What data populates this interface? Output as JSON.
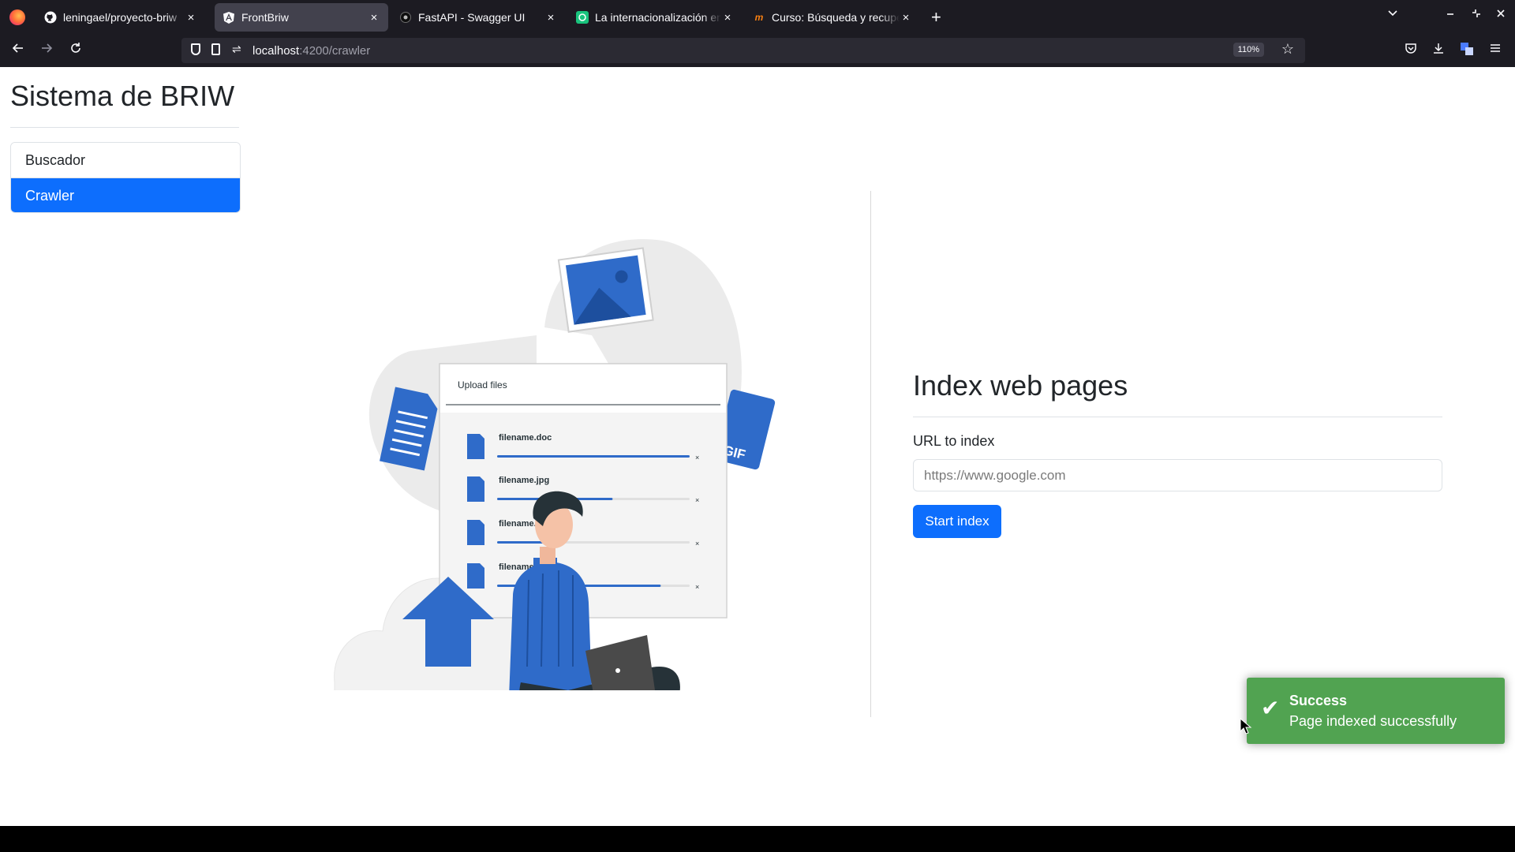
{
  "browser": {
    "tabs": [
      {
        "title": "leningael/proyecto-briw",
        "icon": "github-icon",
        "active": false
      },
      {
        "title": "FrontBriw",
        "icon": "angular-icon",
        "active": true
      },
      {
        "title": "FastAPI - Swagger UI",
        "icon": "swagger-icon",
        "active": false
      },
      {
        "title": "La internacionalización en",
        "icon": "chatgpt-icon",
        "active": false
      },
      {
        "title": "Curso: Búsqueda y recupe",
        "icon": "moodle-icon",
        "active": false
      }
    ],
    "url_host": "localhost",
    "url_path": ":4200/crawler",
    "zoom": "110%"
  },
  "sidebar": {
    "title": "Sistema de BRIW",
    "items": [
      {
        "label": "Buscador",
        "active": false
      },
      {
        "label": "Crawler",
        "active": true
      }
    ]
  },
  "illustration": {
    "header": "Upload files",
    "files": [
      {
        "name": "filename.doc",
        "progress": 1.0
      },
      {
        "name": "filename.jpg",
        "progress": 0.6
      },
      {
        "name": "filename.png",
        "progress": 0.3
      },
      {
        "name": "filename.",
        "progress": 0.85
      }
    ],
    "badge": "GIF"
  },
  "form": {
    "title": "Index web pages",
    "label": "URL to index",
    "placeholder": "https://www.google.com",
    "button": "Start index"
  },
  "toast": {
    "title": "Success",
    "message": "Page indexed successfully"
  },
  "colors": {
    "primary": "#0d6efd",
    "success_toast": "#51a351",
    "illustration_blue": "#2f6bc9",
    "browser_chrome": "#1c1b22"
  }
}
